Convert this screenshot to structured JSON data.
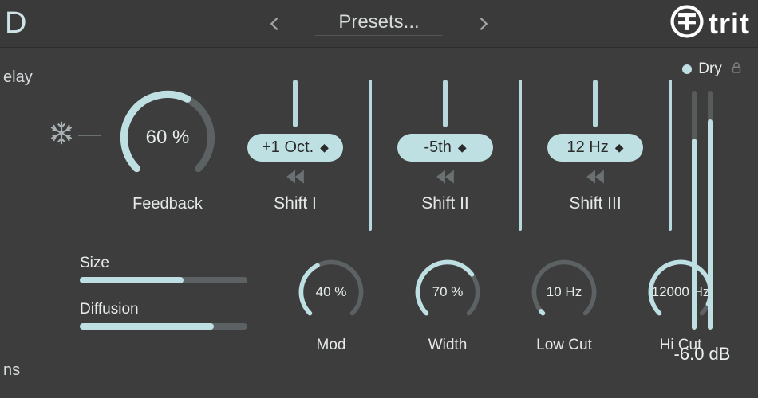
{
  "header": {
    "logo_left": "D",
    "preset_label": "Presets...",
    "brand": "trit"
  },
  "left_rail": {
    "label1": "elay",
    "label2": "ns"
  },
  "feedback": {
    "value": "60 %",
    "label": "Feedback",
    "arc_pct": 0.6
  },
  "shifts": [
    {
      "value": "+1 Oct.",
      "label": "Shift I"
    },
    {
      "value": "-5th",
      "label": "Shift II"
    },
    {
      "value": "12 Hz",
      "label": "Shift III"
    }
  ],
  "sliders": {
    "size": {
      "label": "Size",
      "pct": 0.62
    },
    "diffusion": {
      "label": "Diffusion",
      "pct": 0.8
    }
  },
  "small_knobs": [
    {
      "label": "Mod",
      "value": "40 %",
      "arc_pct": 0.4
    },
    {
      "label": "Width",
      "value": "70 %",
      "arc_pct": 0.7
    },
    {
      "label": "Low Cut",
      "value": "10 Hz",
      "arc_pct": 0.02
    },
    {
      "label": "Hi Cut",
      "value": "12000 Hz",
      "arc_pct": 0.92
    }
  ],
  "output": {
    "dry_label": "Dry",
    "value": "-6.0 dB",
    "level_pct": 0.8,
    "meter_pct": 0.88
  }
}
